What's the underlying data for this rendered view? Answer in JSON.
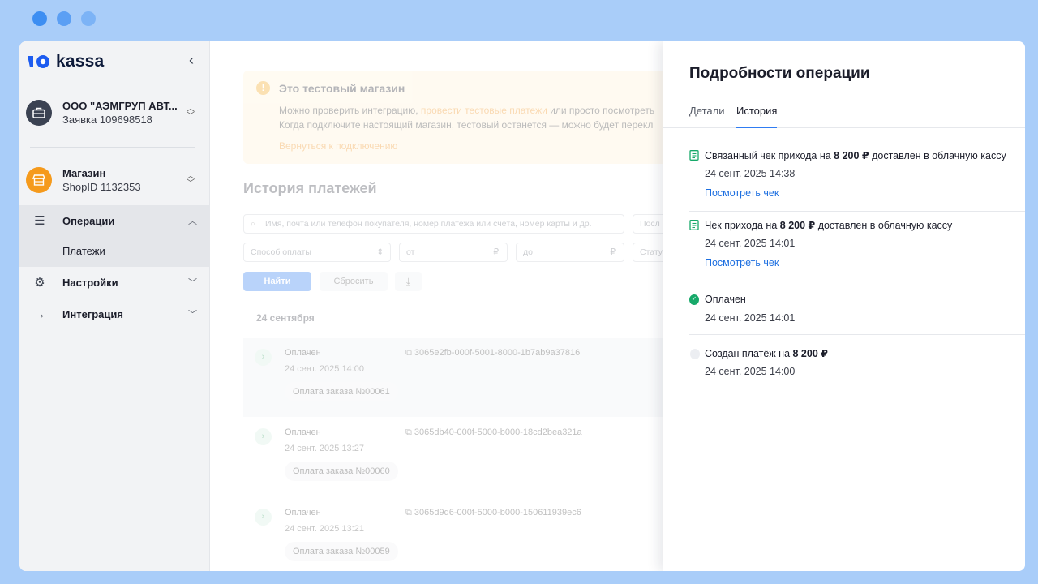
{
  "window": {
    "dots": [
      "close",
      "minimize",
      "maximize"
    ]
  },
  "logo": {
    "text": "kassa"
  },
  "sidebar": {
    "company": {
      "name": "ООО \"АЭМГРУП АВТ...",
      "subtitle": "Заявка 109698518"
    },
    "shop": {
      "name": "Магазин",
      "subtitle": "ShopID 1132353"
    },
    "nav": [
      {
        "label": "Операции",
        "icon": "list-icon",
        "expanded": true
      },
      {
        "label": "Настройки",
        "icon": "gear-icon",
        "expanded": false
      },
      {
        "label": "Интеграция",
        "icon": "arrow-right-icon",
        "expanded": false
      }
    ],
    "sub_item": "Платежи"
  },
  "main": {
    "alert": {
      "title": "Это тестовый магазин",
      "line1_prefix": "Можно проверить интеграцию, ",
      "line1_link": "провести тестовые платежи",
      "line1_suffix": " или просто посмотреть",
      "line2": "Когда подключите настоящий магазин, тестовый останется — можно будет перекл",
      "link": "Вернуться к подключению"
    },
    "heading": "История платежей",
    "search_placeholder": "Имя, почта или телефон покупателя, номер платежа или счёта, номер карты и др.",
    "filter_period": "Посл",
    "filter_method": "Способ оплаты",
    "filter_from": "от",
    "filter_to": "до",
    "currency": "₽",
    "filter_status": "Стату",
    "find_label": "Найти",
    "reset_label": "Сбросить",
    "date_group": "24 сентября",
    "payments": [
      {
        "status": "Оплачен",
        "date": "24 сент. 2025 14:00",
        "order": "Оплата заказа №00061",
        "id": "3065e2fb-000f-5001-8000-1b7ab9a37816"
      },
      {
        "status": "Оплачен",
        "date": "24 сент. 2025 13:27",
        "order": "Оплата заказа №00060",
        "id": "3065db40-000f-5000-b000-18cd2bea321a"
      },
      {
        "status": "Оплачен",
        "date": "24 сент. 2025 13:21",
        "order": "Оплата заказа №00059",
        "id": "3065d9d6-000f-5000-b000-150611939ec6"
      }
    ]
  },
  "panel": {
    "title": "Подробности операции",
    "tabs": [
      "Детали",
      "История"
    ],
    "active_tab": "История",
    "events": [
      {
        "text_prefix": "Связанный чек прихода на ",
        "amount": "8 200 ₽",
        "text_suffix": " доставлен в облачную кассу",
        "date": "24 сент. 2025 14:38",
        "link": "Посмотреть чек",
        "icon": "receipt-icon"
      },
      {
        "text_prefix": "Чек прихода на ",
        "amount": "8 200 ₽",
        "text_suffix": " доставлен в облачную кассу",
        "date": "24 сент. 2025 14:01",
        "link": "Посмотреть чек",
        "icon": "receipt-icon"
      },
      {
        "text_prefix": "Оплачен",
        "amount": "",
        "text_suffix": "",
        "date": "24 сент. 2025 14:01",
        "icon": "check-circle-icon"
      },
      {
        "text_prefix": "Создан платёж на ",
        "amount": "8 200 ₽",
        "text_suffix": "",
        "date": "24 сент. 2025 14:00",
        "icon": "dot-icon"
      }
    ]
  },
  "colors": {
    "accent": "#2f7cf2",
    "link": "#1d6fe0",
    "success": "#17a96a",
    "warning": "#f1a51b",
    "backdrop": "#a9cdf9"
  }
}
